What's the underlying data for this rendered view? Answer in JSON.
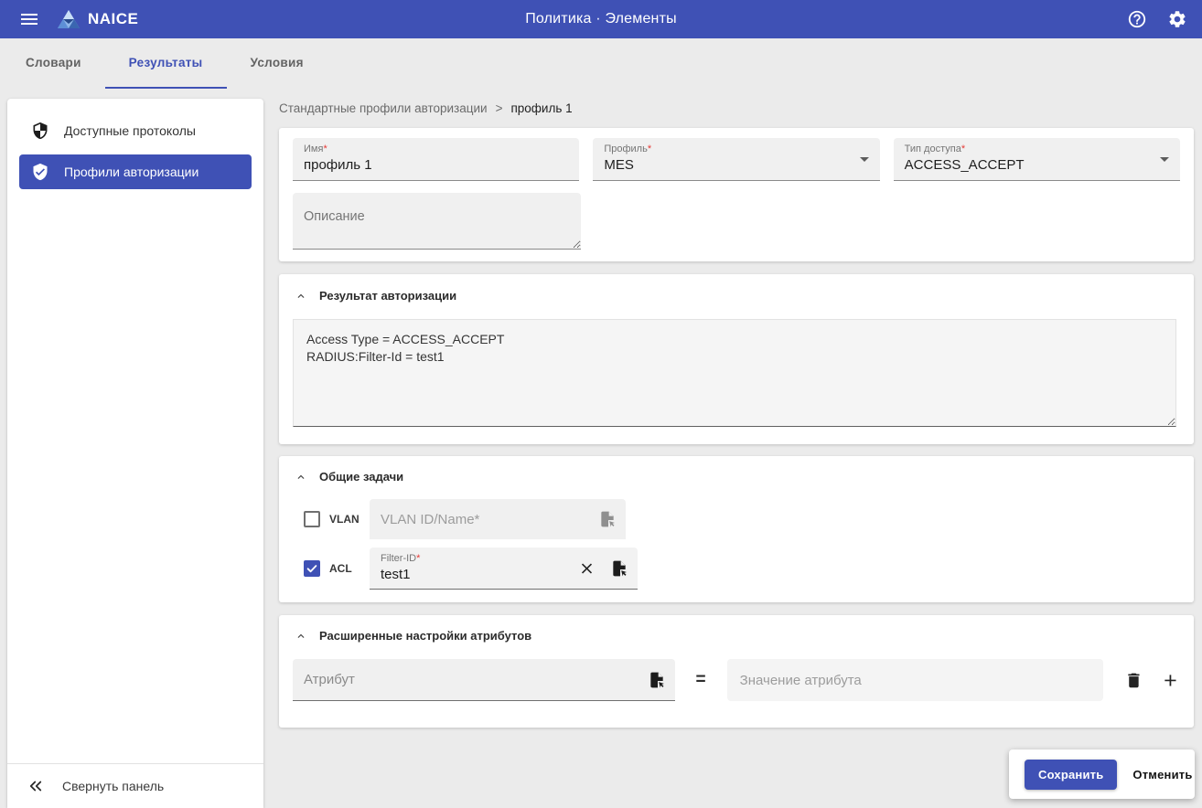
{
  "ui": {
    "required_mark": "*"
  },
  "colors": {
    "primary": "#3f51b5",
    "required_asterisk": "#e53935",
    "page_bg": "#ebebeb"
  },
  "header": {
    "brand": "NAICE",
    "title": "Политика · Элементы",
    "icons": [
      "menu-icon",
      "logo-triangle",
      "help-icon",
      "settings-gear-icon"
    ]
  },
  "tabs": [
    {
      "label": "Словари",
      "active": false
    },
    {
      "label": "Результаты",
      "active": true
    },
    {
      "label": "Условия",
      "active": false
    }
  ],
  "sidebar": {
    "items": [
      {
        "label": "Доступные протоколы",
        "icon": "shield-security-icon",
        "selected": false
      },
      {
        "label": "Профили авторизации",
        "icon": "shield-check-icon",
        "selected": true
      }
    ],
    "collapse_label": "Свернуть панель",
    "collapse_icon": "double-chevron-left-icon"
  },
  "breadcrumb": {
    "parent": "Стандартные профили авторизации",
    "separator": ">",
    "current": "профиль 1"
  },
  "form": {
    "name": {
      "label": "Имя",
      "required": true,
      "value": "профиль 1"
    },
    "profile": {
      "label": "Профиль",
      "required": true,
      "value": "MES"
    },
    "access_type": {
      "label": "Тип доступа",
      "required": true,
      "value": "ACCESS_ACCEPT"
    },
    "description": {
      "placeholder": "Описание",
      "value": ""
    }
  },
  "authorization_result": {
    "title": "Результат авторизации",
    "value": "Access Type = ACCESS_ACCEPT\nRADIUS:Filter-Id = test1"
  },
  "common_tasks": {
    "title": "Общие задачи",
    "vlan": {
      "label": "VLAN",
      "checked": false,
      "placeholder": "VLAN ID/Name*",
      "icon": "dictionary-file-icon"
    },
    "acl": {
      "label": "ACL",
      "checked": true,
      "field_label": "Filter-ID",
      "required": true,
      "value": "test1",
      "icons": [
        "clear-x-icon",
        "dictionary-file-icon"
      ]
    }
  },
  "advanced_attributes": {
    "title": "Расширенные настройки атрибутов",
    "attribute_placeholder": "Атрибут",
    "equals": "=",
    "value_placeholder": "Значение атрибута",
    "icons": [
      "dictionary-file-icon",
      "delete-trash-icon",
      "add-plus-icon"
    ]
  },
  "actions": {
    "save": "Сохранить",
    "cancel": "Отменить"
  }
}
